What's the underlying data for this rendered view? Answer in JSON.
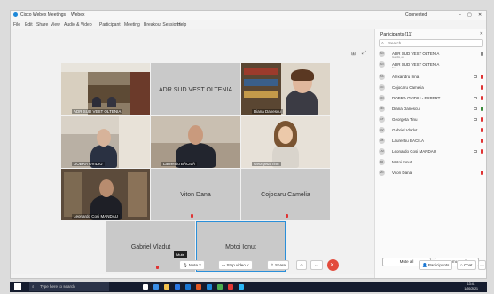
{
  "window": {
    "title": "Cisco Webex Meetings",
    "title_extra": "Webex",
    "right_label": "Connected",
    "controls": [
      "–",
      "▢",
      "✕"
    ]
  },
  "menu": [
    "File",
    "Edit",
    "Share",
    "View",
    "Audio & Video",
    "Participant",
    "Meeting",
    "Breakout Sessions",
    "Help"
  ],
  "stage": {
    "tiles": [
      {
        "name": "ADR SUD VEST OLTENIA",
        "label": "ADR SUD VEST OLTENIA",
        "video": true
      },
      {
        "name": "ADR SUD VEST OLTENIA",
        "big": "ADR SUD VEST OLTENIA",
        "video": false
      },
      {
        "name": "Diana Danescu",
        "label": "Diana Danescu",
        "video": true
      },
      {
        "name": "DOBRA OVIDIU",
        "label": "DOBRA OVIDIU",
        "video": true
      },
      {
        "name": "Laurentiu BĂCILĂ",
        "label": "Laurentiu BĂCILĂ",
        "video": true
      },
      {
        "name": "Georgeta Tinu",
        "label": "Georgeta Tinu",
        "video": true
      },
      {
        "name": "Leonardo Cosi MANDAU",
        "label": "Leonardo Cosi MANDAU",
        "video": true
      },
      {
        "name": "Viton Dana",
        "big": "Viton Dana",
        "video": false
      },
      {
        "name": "Cojocaru Camelia",
        "big": "Cojocaru Camelia",
        "video": false
      },
      {
        "name": "Gabriel Vladut",
        "big": "Gabriel Vladut",
        "video": false
      },
      {
        "name": "Motoi Ionut",
        "big": "Motoi Ionut",
        "video": false
      }
    ]
  },
  "panel": {
    "title": "Participants (11)",
    "search_placeholder": "Search",
    "participants": [
      {
        "initials": "AO",
        "name": "ADR SUD VEST OLTENIA",
        "sub": "Gazdă, eu"
      },
      {
        "initials": "AO",
        "name": "ADR SUD VEST OLTENIA",
        "sub": "Eu"
      },
      {
        "initials": "AS",
        "name": "Alexandru Irina",
        "sub": ""
      },
      {
        "initials": "CC",
        "name": "Cojocaru Camelia",
        "sub": ""
      },
      {
        "initials": "DO",
        "name": "DOBRA OVIDIU - EXPERT",
        "sub": ""
      },
      {
        "initials": "DD",
        "name": "Diana Danescu",
        "sub": ""
      },
      {
        "initials": "GT",
        "name": "Georgeta Tinu",
        "sub": ""
      },
      {
        "initials": "GV",
        "name": "Gabriel Vladut",
        "sub": ""
      },
      {
        "initials": "LB",
        "name": "Laurentiu BĂCILĂ",
        "sub": ""
      },
      {
        "initials": "LM",
        "name": "Leonardo Cosi MANDAU",
        "sub": ""
      },
      {
        "initials": "MI",
        "name": "Motoi Ionut",
        "sub": ""
      },
      {
        "initials": "VD",
        "name": "Viton Dana",
        "sub": ""
      }
    ],
    "mute_all": "Mute all",
    "unmute_all": "Unmute all"
  },
  "toolbar": {
    "mute": "Mute",
    "stop_video": "Stop video",
    "share": "Share",
    "participants": "Participants",
    "chat": "Chat",
    "tooltip": "Mute"
  },
  "taskbar": {
    "search_placeholder": "Type here to search",
    "time": "13:41",
    "date": "1/20/2021"
  }
}
